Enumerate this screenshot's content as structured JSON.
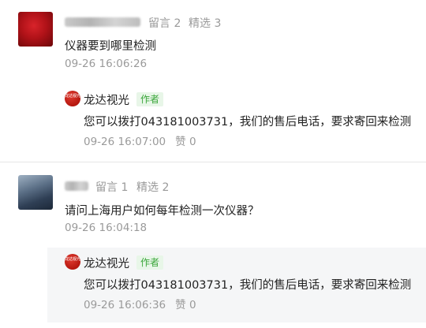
{
  "comments": [
    {
      "stats": {
        "messages": "留言 2",
        "featured": "精选 3"
      },
      "text": "仪器要到哪里检测",
      "time": "09-26 16:06:26",
      "reply": {
        "author": "龙达视光",
        "logo_text": "龙达视光",
        "badge": "作者",
        "text": "您可以拨打043181003731，我们的售后电话，要求寄回来检测",
        "time": "09-26 16:07:00",
        "likes": "赞 0"
      }
    },
    {
      "stats": {
        "messages": "留言 1",
        "featured": "精选 2"
      },
      "text": "请问上海用户如何每年检测一次仪器？",
      "time": "09-26 16:04:18",
      "reply": {
        "author": "龙达视光",
        "logo_text": "龙达视光",
        "badge": "作者",
        "text": "您可以拨打043181003731，我们的售后电话，要求寄回来检测",
        "time": "09-26 16:06:36",
        "likes": "赞 0"
      }
    }
  ],
  "colors": {
    "accent_green": "#3aa63a",
    "logo_red": "#c8201a",
    "reply_bg": "#f5f6f7"
  }
}
